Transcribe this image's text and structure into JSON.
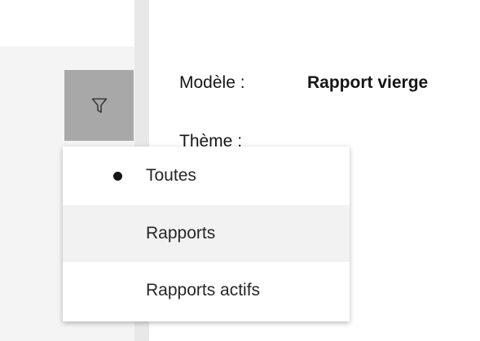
{
  "icons": {
    "filter": "filter-icon",
    "selected_bullet": "bullet-icon"
  },
  "colors": {
    "filter_button_bg": "#a8a8a8",
    "panel_bg": "#f4f4f4",
    "hover_bg": "#f2f2f2",
    "text": "#161616"
  },
  "fields": {
    "model_label": "Modèle :",
    "model_value": "Rapport vierge",
    "theme_label": "Thème :"
  },
  "filter_menu": {
    "items": [
      {
        "label": "Toutes",
        "selected": true
      },
      {
        "label": "Rapports",
        "selected": false,
        "hovered": true
      },
      {
        "label": "Rapports actifs",
        "selected": false
      }
    ]
  }
}
